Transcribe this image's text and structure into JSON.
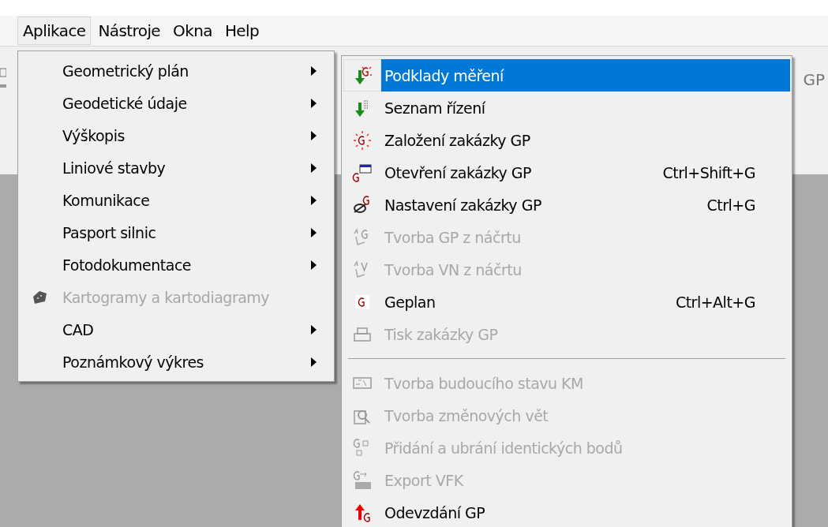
{
  "menubar": [
    {
      "label": "Aplikace",
      "selected": true
    },
    {
      "label": "Nástroje",
      "selected": false
    },
    {
      "label": "Okna",
      "selected": false
    },
    {
      "label": "Help",
      "selected": false
    }
  ],
  "toolbar_text": "GP",
  "main_menu": [
    {
      "label": "Geometrický plán",
      "submenu": true,
      "disabled": false
    },
    {
      "label": "Geodetické údaje",
      "submenu": true,
      "disabled": false
    },
    {
      "label": "Výškopis",
      "submenu": true,
      "disabled": false
    },
    {
      "label": "Liniové stavby",
      "submenu": true,
      "disabled": false
    },
    {
      "label": "Komunikace",
      "submenu": true,
      "disabled": false
    },
    {
      "label": "Pasport silnic",
      "submenu": true,
      "disabled": false
    },
    {
      "label": "Fotodokumentace",
      "submenu": true,
      "disabled": false
    },
    {
      "label": "Kartogramy a kartodiagramy",
      "submenu": false,
      "disabled": true
    },
    {
      "label": "CAD",
      "submenu": true,
      "disabled": false
    },
    {
      "label": "Poznámkový výkres",
      "submenu": true,
      "disabled": false
    }
  ],
  "submenu": [
    {
      "kind": "item",
      "label": "Podklady měření",
      "disabled": false,
      "selected": true
    },
    {
      "kind": "item",
      "label": "Seznam řízení",
      "disabled": false,
      "selected": false
    },
    {
      "kind": "item",
      "label": "Založení zakázky GP",
      "disabled": false,
      "selected": false
    },
    {
      "kind": "item",
      "label": "Otevření zakázky GP",
      "shortcut": "Ctrl+Shift+G",
      "disabled": false,
      "selected": false
    },
    {
      "kind": "item",
      "label": "Nastavení zakázky GP",
      "shortcut": "Ctrl+G",
      "disabled": false,
      "selected": false
    },
    {
      "kind": "item",
      "label": "Tvorba GP z náčrtu",
      "disabled": true,
      "selected": false
    },
    {
      "kind": "item",
      "label": "Tvorba VN z náčrtu",
      "disabled": true,
      "selected": false
    },
    {
      "kind": "item",
      "label": "Geplan",
      "shortcut": "Ctrl+Alt+G",
      "disabled": false,
      "selected": false
    },
    {
      "kind": "item",
      "label": "Tisk zakázky GP",
      "disabled": true,
      "selected": false
    },
    {
      "kind": "separator"
    },
    {
      "kind": "item",
      "label": "Tvorba budoucího stavu KM",
      "disabled": true,
      "selected": false
    },
    {
      "kind": "item",
      "label": "Tvorba změnových vět",
      "disabled": true,
      "selected": false
    },
    {
      "kind": "item",
      "label": "Přidání a ubrání identických bodů",
      "disabled": true,
      "selected": false
    },
    {
      "kind": "item",
      "label": "Export VFK",
      "disabled": true,
      "selected": false
    },
    {
      "kind": "item",
      "label": "Odevzdání GP",
      "disabled": false,
      "selected": false
    }
  ]
}
